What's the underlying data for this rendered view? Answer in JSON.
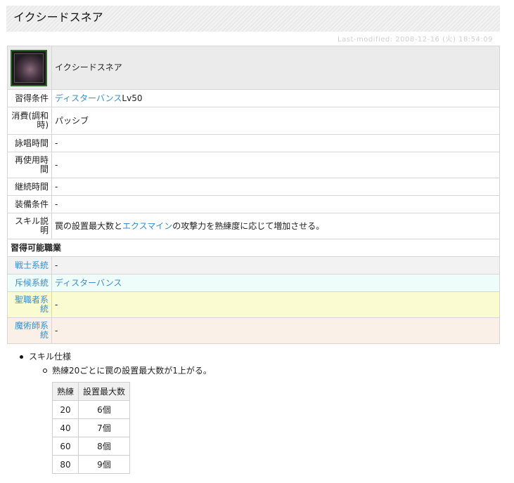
{
  "page": {
    "title": "イクシードスネア",
    "last_modified": "Last-modified: 2008-12-16 (火) 18:54:09"
  },
  "skill": {
    "icon": "skill-icon-exceed-snare",
    "name": "イクシードスネア",
    "rows": [
      {
        "label": "習得条件",
        "link": "ディスターバンス",
        "value": "Lv50"
      },
      {
        "label": "消費(調和時)",
        "value": "パッシブ"
      },
      {
        "label": "詠唱時間",
        "value": "-"
      },
      {
        "label": "再使用時間",
        "value": "-"
      },
      {
        "label": "継続時間",
        "value": "-"
      },
      {
        "label": "装備条件",
        "value": "-"
      },
      {
        "label": "スキル説明",
        "pre": "罠の設置最大数と",
        "link": "エクスマイン",
        "post": "の攻撃力を熟練度に応じて増加させる。"
      }
    ]
  },
  "jobs": {
    "heading": "習得可能職業",
    "rows": [
      {
        "label": "戦士系統",
        "value": "-"
      },
      {
        "label": "斥候系統",
        "value": "ディスターバンス"
      },
      {
        "label": "聖職者系統",
        "value": "-"
      },
      {
        "label": "魔術師系統",
        "value": "-"
      }
    ]
  },
  "spec": {
    "heading": "スキル仕様",
    "sub": "熟練20ごとに罠の設置最大数が1上がる。",
    "table": {
      "headers": [
        "熟練",
        "設置最大数"
      ],
      "rows": [
        [
          "20",
          "6個"
        ],
        [
          "40",
          "7個"
        ],
        [
          "60",
          "8個"
        ],
        [
          "80",
          "9個"
        ]
      ]
    }
  },
  "colors": {
    "link": "#3a8dc5",
    "warrior_row": "#f2f2f2",
    "scout_row": "#eefcfa",
    "priest_row": "#fbfbd2",
    "mage_row": "#fbf0e8"
  }
}
